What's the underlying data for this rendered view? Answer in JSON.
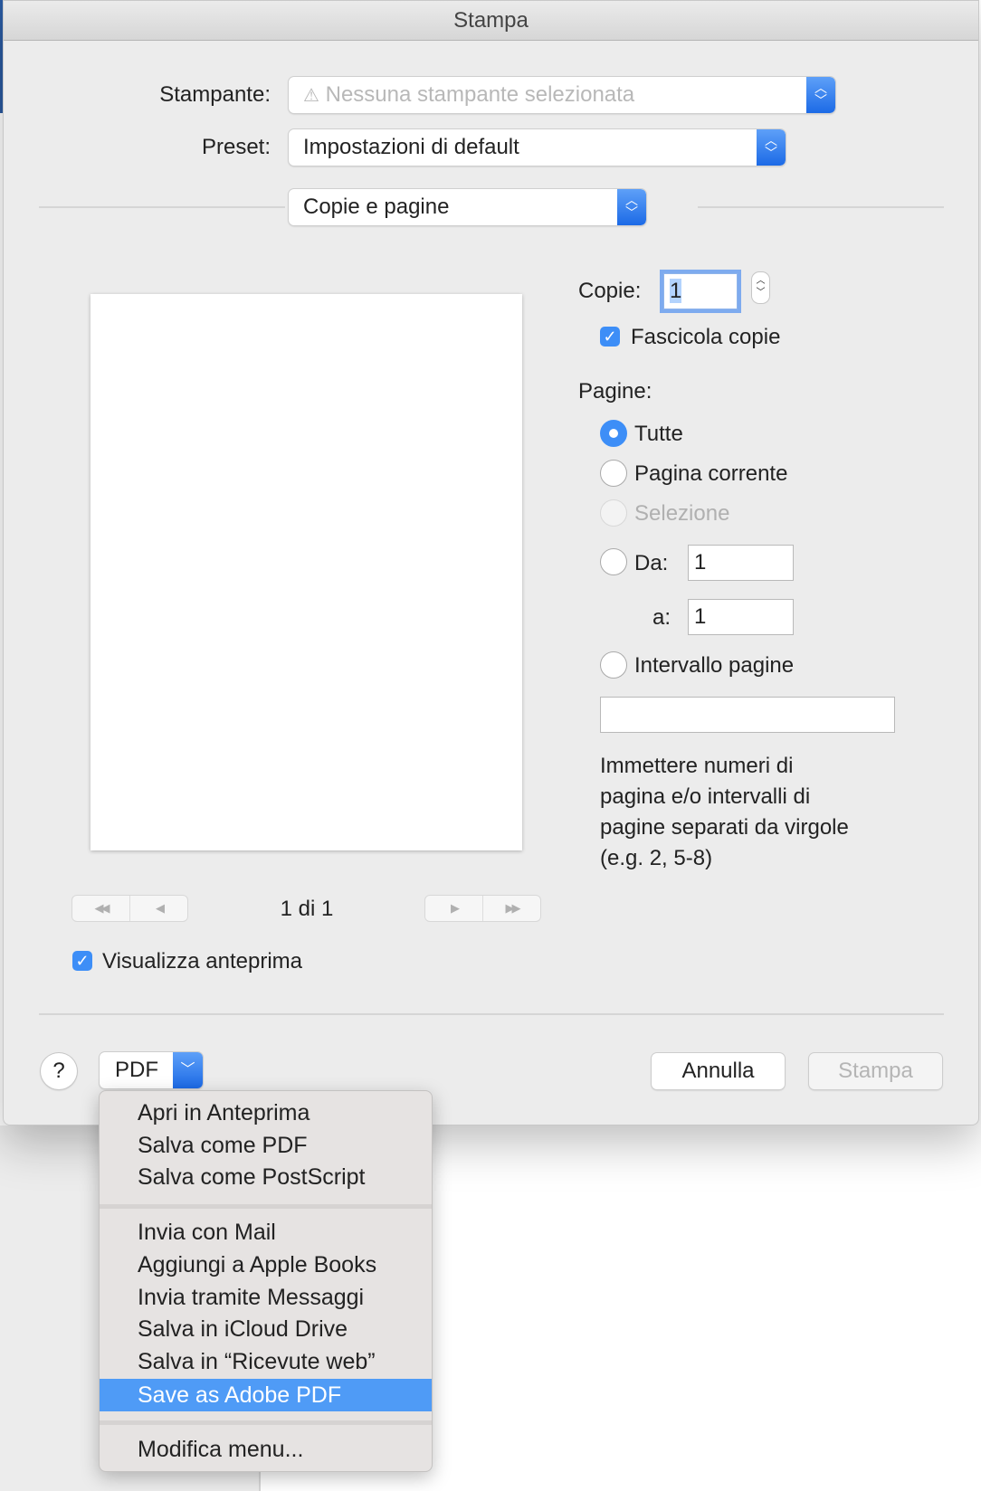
{
  "window": {
    "title": "Stampa"
  },
  "printer": {
    "label": "Stampante:",
    "value": "Nessuna stampante selezionata"
  },
  "preset": {
    "label": "Preset:",
    "value": "Impostazioni di default"
  },
  "section": {
    "value": "Copie e pagine"
  },
  "copies": {
    "label": "Copie:",
    "value": "1",
    "collate_label": "Fascicola copie",
    "collate_checked": true
  },
  "pages": {
    "label": "Pagine:",
    "all": "Tutte",
    "current": "Pagina corrente",
    "selection": "Selezione",
    "from_label": "Da:",
    "from_value": "1",
    "to_label": "a:",
    "to_value": "1",
    "range": "Intervallo pagine",
    "range_value": "",
    "help": [
      "Immettere numeri di",
      "pagina e/o intervalli di",
      "pagine separati da virgole",
      "(e.g. 2, 5-8)"
    ],
    "selected": "Tutte"
  },
  "preview": {
    "page_indicator": "1 di 1",
    "show_preview_label": "Visualizza anteprima",
    "show_preview_checked": true
  },
  "footer": {
    "help": "?",
    "pdf": "PDF",
    "cancel": "Annulla",
    "print": "Stampa"
  },
  "pdf_menu": {
    "items": [
      "Apri in Anteprima",
      "Salva come PDF",
      "Salva come PostScript",
      "Invia con Mail",
      "Aggiungi a Apple Books",
      "Invia tramite Messaggi",
      "Salva in iCloud Drive",
      "Salva in “Ricevute web”",
      "Save as Adobe PDF",
      "Modifica menu..."
    ],
    "highlighted": "Save as Adobe PDF"
  }
}
